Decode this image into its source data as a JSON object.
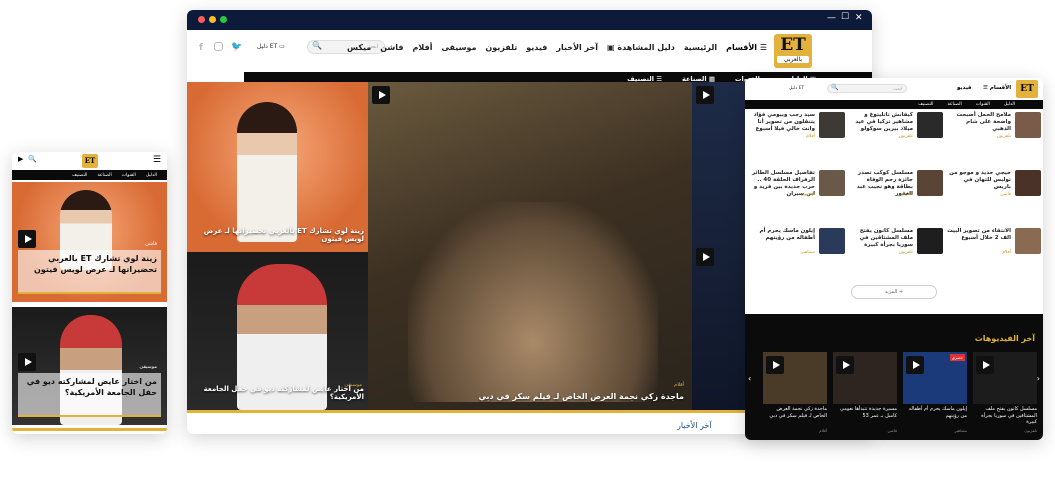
{
  "browser": {
    "close_glyph": "✕",
    "max_glyph": "☐",
    "min_glyph": "—"
  },
  "logo": {
    "text": "ET",
    "sub": "بالعربي"
  },
  "nav": {
    "sections": "الأقسام",
    "items": [
      "الرئيسية",
      "دليل المشاهدة",
      "آخر الأخبار",
      "فيديو",
      "تلفزيون",
      "موسيقى",
      "أفلام",
      "فاشن",
      "ميكس"
    ],
    "search_placeholder": "ابحث",
    "tv_guide": "دليل ET"
  },
  "subnav": [
    "الدليل",
    "القنوات",
    "الصناعة",
    "التصنيف"
  ],
  "hero": {
    "top_left_caption": "زينة لوي تشارك ET بالعربي تحضيراتها لـ عرض لويس فيتون",
    "bottom_left_caption": "من اختار عايض لمشاركته ديو في حفل الجامعة الأمريكية؟",
    "bottom_left_cat": "موسيقى",
    "main_caption": "ماجدة زكي نجمة العرض الخاص لـ فيلم سكر في دبي",
    "main_cat": "أفلام",
    "more_news": "آخر الأخبار"
  },
  "mobile": {
    "card1_cat": "فاشن",
    "card1_caption": "زينة لوي تشارك ET بالعربي تحضيراتها لـ عرض لويس فيتون",
    "card2_cat": "موسيقى",
    "card2_caption": "من اختار عايض لمشاركته ديو في حفل الجامعة الأمريكية؟",
    "subnav": [
      "الدليل",
      "القنوات",
      "الصناعة",
      "التصنيف"
    ]
  },
  "tablet": {
    "nav_sections": "الأقسام",
    "nav_video": "فيديو",
    "search_placeholder": "ابحث",
    "tv_guide": "دليل ET",
    "subnav": [
      "الدليل",
      "القنوات",
      "الصناعة",
      "التصنيف"
    ],
    "articles": [
      {
        "title": "ملامح الحمل أصبحت واضحة على شام الذهبي",
        "cat": "تلفزيون"
      },
      {
        "title": "كيفانش تاتليتوغ و مشاهير تركيا في عيد ميلاد بيرين سوكولو",
        "cat": "تلفزيون"
      },
      {
        "title": "سيد رجب وبيومي فؤاد يتنقلون من تصوير أنا وانت خالي فيلا أسبوع",
        "cat": "أفلام"
      },
      {
        "title": "جيجي حديد و موجو من توليس للتهان في باريس",
        "cat": "فاشن"
      },
      {
        "title": "مسلسل كوكب تصدر جائزة رحم الوفاة بطاقة وهو نجيب عبد الغفور",
        "cat": "تلفزيون"
      },
      {
        "title": "تفاصيل مسلسل الطائر الرفراف الحلقة 40 .. حرب جديدة بين فريد و ابن سيران",
        "cat": "تلفزيون"
      },
      {
        "title": "الانتقاء من تصوير البيت الف 2 خلال أسبوع",
        "cat": "أفلام"
      },
      {
        "title": "مسلسل كانون يفتح ملف المشتاقين في سوريا بجرأة كبيرة",
        "cat": "تلفزيون"
      },
      {
        "title": "إيلون ماسك يحرم أم أطفاله من رؤيتهم",
        "cat": "مشاهير"
      }
    ],
    "more_button": "المزيد +",
    "videos_heading": "آخر الفيديوهات",
    "videos": [
      {
        "title": "مسلسل كانون يفتح ملف المشتاقين في سوريا بجرأة كبيرة",
        "cat": "تلفزيون"
      },
      {
        "title": "إيلون ماسك يحرم أم أطفاله من رؤيتهم",
        "cat": "مشاهير"
      },
      {
        "title": "مسيرة جديدة تتبدأها نعومي كامبل بـ عمر 53",
        "cat": "فاشن"
      },
      {
        "title": "ماجدة زكي نجمة العرض الخاص لـ فيلم سكر في دبي",
        "cat": "أفلام"
      }
    ],
    "badge": "حصري"
  },
  "colors": {
    "gold": "#e0b23a",
    "dark": "#111111",
    "navy": "#0b1b3a"
  }
}
